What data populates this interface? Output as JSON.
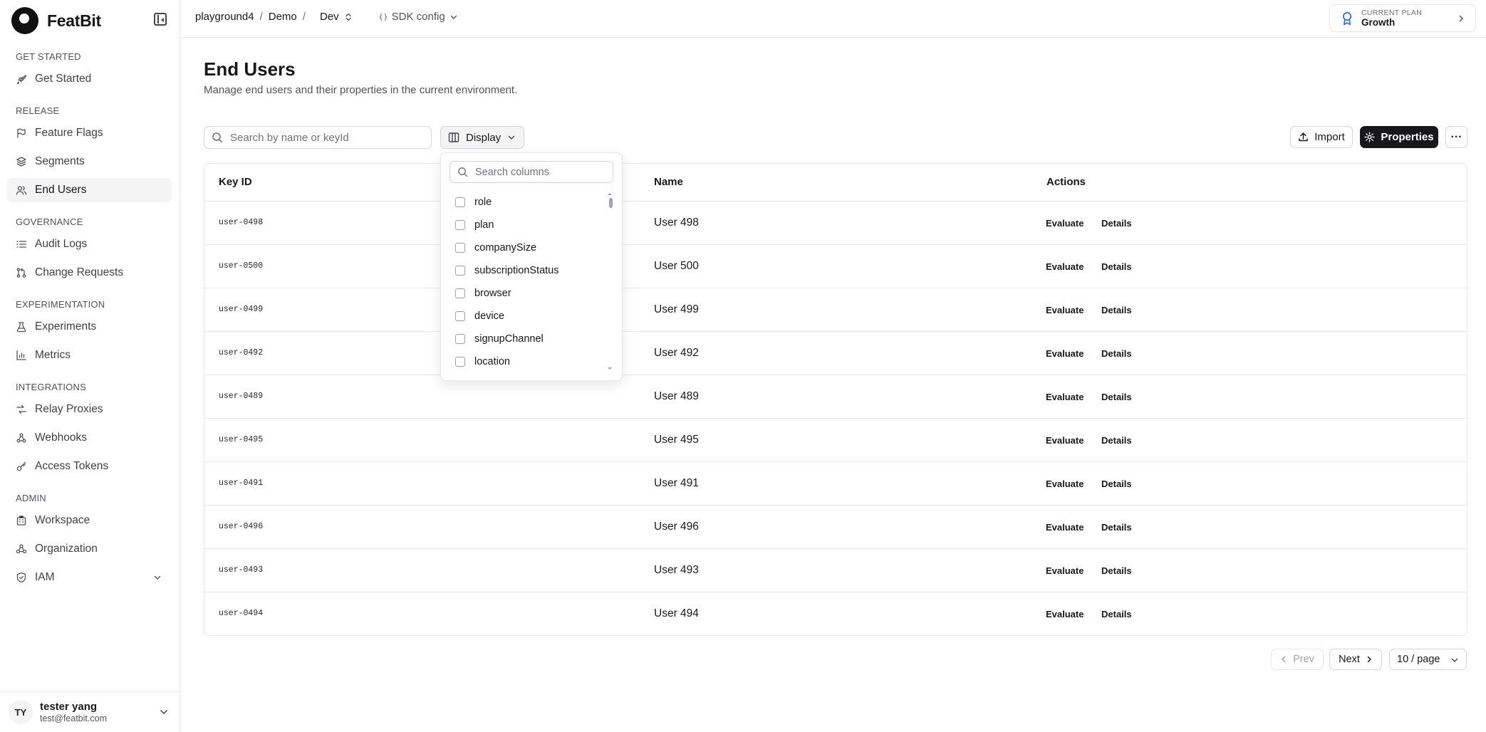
{
  "app": {
    "name": "FeatBit"
  },
  "sidebar": {
    "sections": [
      {
        "title": "GET STARTED",
        "items": [
          {
            "label": "Get Started",
            "icon": "rocket-icon"
          }
        ]
      },
      {
        "title": "RELEASE",
        "items": [
          {
            "label": "Feature Flags",
            "icon": "flag-icon"
          },
          {
            "label": "Segments",
            "icon": "layers-icon"
          },
          {
            "label": "End Users",
            "icon": "users-icon",
            "active": true
          }
        ]
      },
      {
        "title": "GOVERNANCE",
        "items": [
          {
            "label": "Audit Logs",
            "icon": "list-icon"
          },
          {
            "label": "Change Requests",
            "icon": "git-pull-request-icon"
          }
        ]
      },
      {
        "title": "EXPERIMENTATION",
        "items": [
          {
            "label": "Experiments",
            "icon": "flask-icon"
          },
          {
            "label": "Metrics",
            "icon": "bar-chart-icon"
          }
        ]
      },
      {
        "title": "INTEGRATIONS",
        "items": [
          {
            "label": "Relay Proxies",
            "icon": "relay-icon"
          },
          {
            "label": "Webhooks",
            "icon": "webhook-icon"
          },
          {
            "label": "Access Tokens",
            "icon": "key-icon"
          }
        ]
      },
      {
        "title": "ADMIN",
        "items": [
          {
            "label": "Workspace",
            "icon": "building-icon"
          },
          {
            "label": "Organization",
            "icon": "organization-icon"
          },
          {
            "label": "IAM",
            "icon": "shield-icon",
            "expandable": true
          }
        ]
      }
    ],
    "user": {
      "initials": "TY",
      "name": "tester yang",
      "email": "test@featbit.com"
    }
  },
  "topbar": {
    "breadcrumb": {
      "project": "playground4",
      "sep1": "/",
      "org": "Demo",
      "sep2": "/",
      "env": "Dev"
    },
    "sdk_config": "SDK config",
    "plan": {
      "caption": "CURRENT PLAN",
      "name": "Growth"
    }
  },
  "page": {
    "title": "End Users",
    "description": "Manage end users and their properties in the current environment."
  },
  "toolbar": {
    "search_placeholder": "Search by name or keyId",
    "display_label": "Display",
    "import_label": "Import",
    "properties_label": "Properties",
    "more_label": "···"
  },
  "display_menu": {
    "search_placeholder": "Search columns",
    "columns": [
      "role",
      "plan",
      "companySize",
      "subscriptionStatus",
      "browser",
      "device",
      "signupChannel",
      "location"
    ]
  },
  "table": {
    "headers": {
      "key": "Key ID",
      "name": "Name",
      "actions": "Actions"
    },
    "rows": [
      {
        "key": "user-0498",
        "name": "User 498"
      },
      {
        "key": "user-0500",
        "name": "User 500"
      },
      {
        "key": "user-0499",
        "name": "User 499"
      },
      {
        "key": "user-0492",
        "name": "User 492"
      },
      {
        "key": "user-0489",
        "name": "User 489"
      },
      {
        "key": "user-0495",
        "name": "User 495"
      },
      {
        "key": "user-0491",
        "name": "User 491"
      },
      {
        "key": "user-0496",
        "name": "User 496"
      },
      {
        "key": "user-0493",
        "name": "User 493"
      },
      {
        "key": "user-0494",
        "name": "User 494"
      }
    ],
    "actions": {
      "evaluate": "Evaluate",
      "details": "Details"
    }
  },
  "pagination": {
    "prev": "Prev",
    "next": "Next",
    "page_size": "10 / page"
  },
  "colors": {
    "primary_button": "#18181b",
    "active_nav_bg": "#f4f4f5",
    "border": "#e5e7eb"
  }
}
